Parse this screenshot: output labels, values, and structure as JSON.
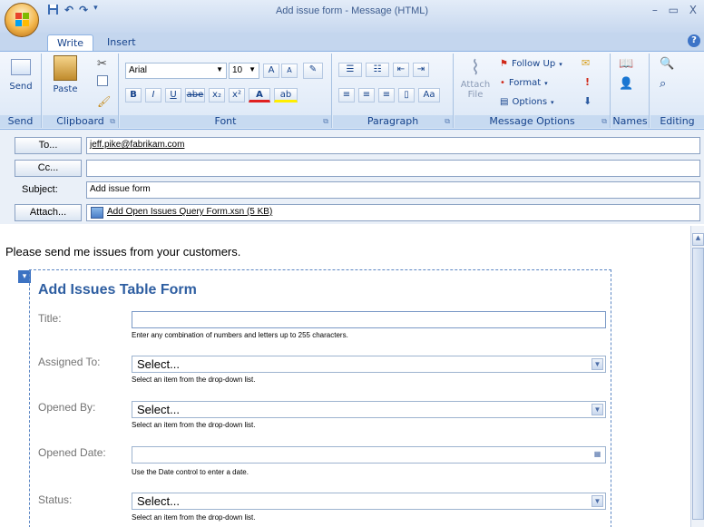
{
  "window": {
    "title": "Add issue form - Message (HTML)",
    "controls": "– ▭ X"
  },
  "qat": {
    "save": "save-icon",
    "undo": "undo-icon",
    "redo": "redo-icon"
  },
  "tabs": [
    {
      "label": "Write"
    },
    {
      "label": "Insert"
    }
  ],
  "help": "?",
  "ribbon": {
    "send": {
      "label": "Send",
      "group": "Send"
    },
    "clipboard": {
      "paste": "Paste",
      "group": "Clipboard"
    },
    "font": {
      "name": "Arial",
      "size": "10",
      "group": "Font",
      "bold": "B",
      "italic": "I",
      "underline": "U",
      "strike": "abe",
      "sub": "x₂",
      "sup": "x²",
      "color": "A",
      "grow": "A",
      "shrink": "A",
      "highlight": "ab"
    },
    "paragraph": {
      "group": "Paragraph"
    },
    "message_options": {
      "attach": "Attach",
      "attach2": "File",
      "follow_up": "Follow Up",
      "format": "Format",
      "options": "Options",
      "group": "Message Options"
    },
    "names": {
      "group": "Names"
    },
    "editing": {
      "group": "Editing"
    }
  },
  "header": {
    "to_button": "To...",
    "to_value": "jeff.pike@fabrikam.com",
    "cc_button": "Cc...",
    "cc_value": "",
    "subject_label": "Subject:",
    "subject_value": "Add issue form",
    "attach_button": "Attach...",
    "attachment": "Add Open Issues Query Form.xsn (5 KB)"
  },
  "body": {
    "message": "Please send me issues from your customers.",
    "form_title": "Add Issues Table Form",
    "fields": [
      {
        "label": "Title:",
        "value": "",
        "hint": "Enter any combination of numbers and letters up to 255 characters."
      },
      {
        "label": "Assigned To:",
        "value": "Select...",
        "hint": "Select an item from the drop-down list."
      },
      {
        "label": "Opened By:",
        "value": "Select...",
        "hint": "Select an item from the drop-down list."
      },
      {
        "label": "Opened Date:",
        "value": "",
        "hint": "Use the Date control to enter a date."
      },
      {
        "label": "Status:",
        "value": "Select...",
        "hint": "Select an item from the drop-down list."
      }
    ]
  }
}
